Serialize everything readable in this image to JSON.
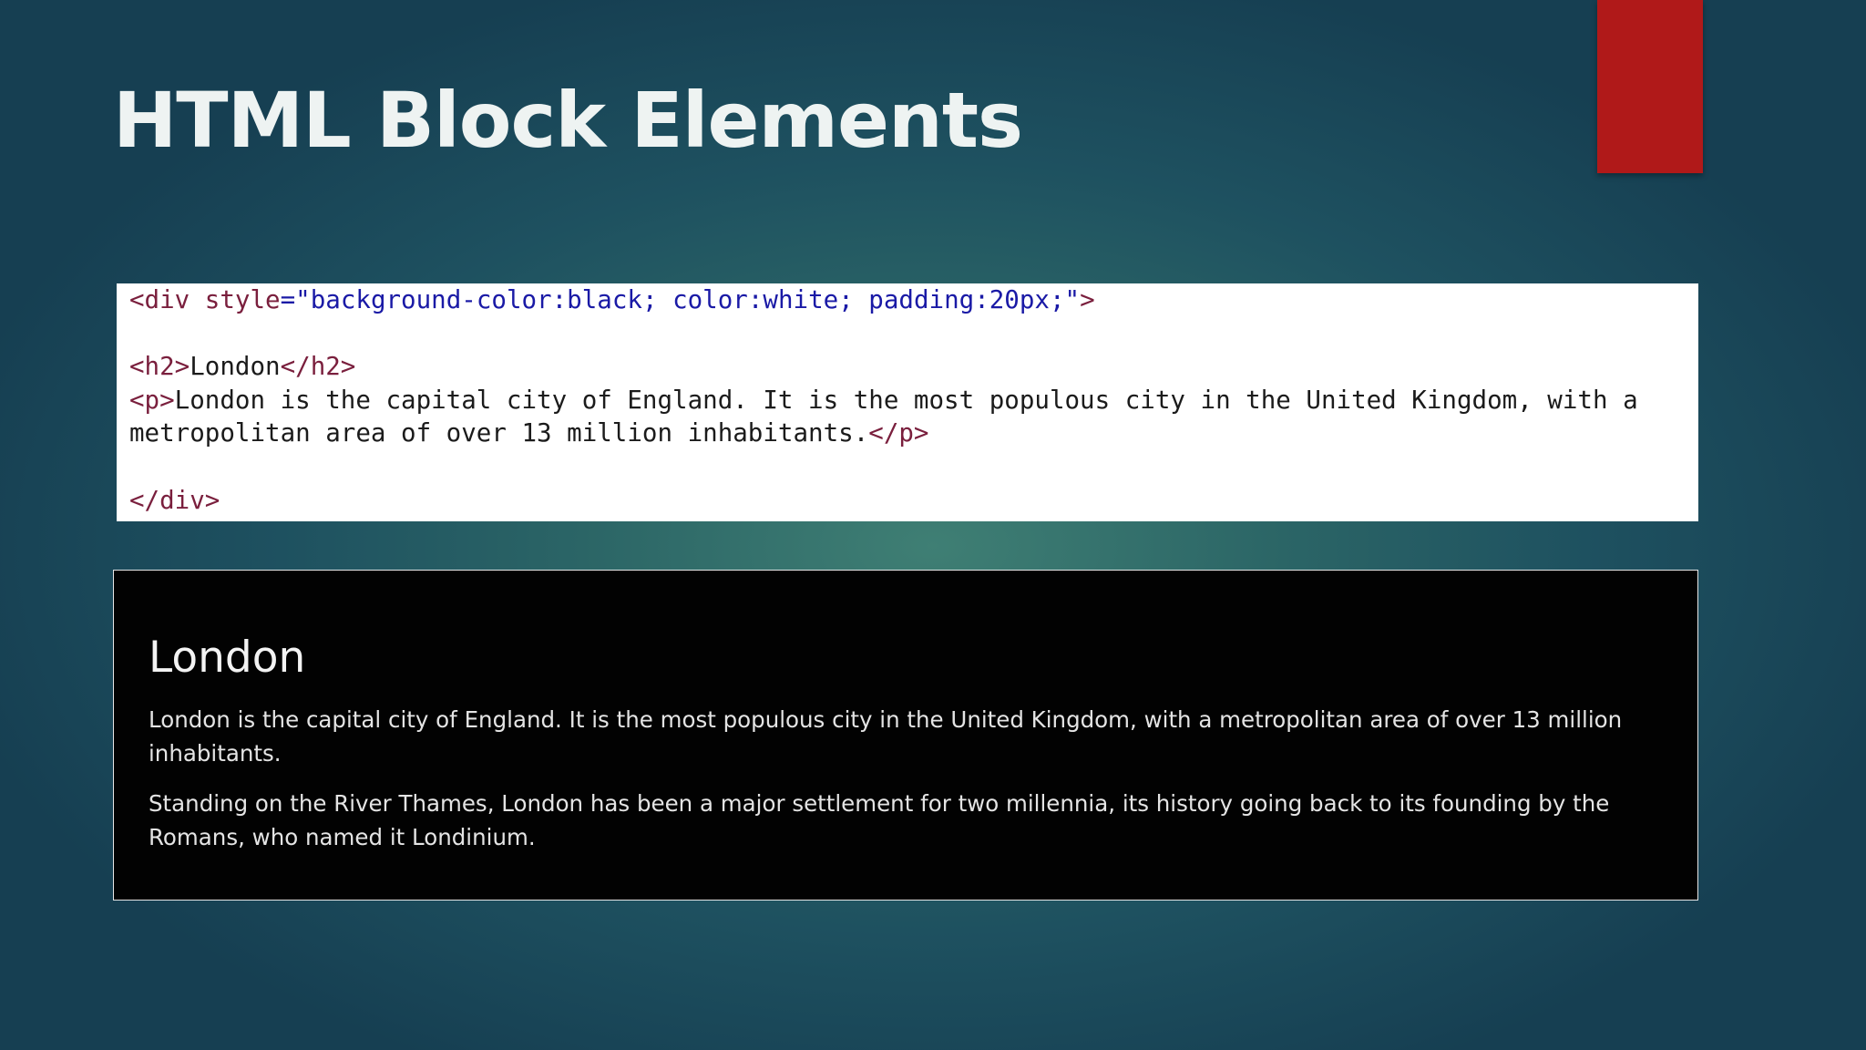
{
  "slide": {
    "title": "HTML Block Elements",
    "accent_color": "#b01919"
  },
  "code_panel": {
    "line1": {
      "tag_open": "<div ",
      "attr_name": "style",
      "equals": "=",
      "attr_value": "\"background-color:black; color:white; padding:20px;\"",
      "tag_close": ">"
    },
    "line2": {
      "tag_open": "<h2>",
      "text": "London",
      "tag_close": "</h2>"
    },
    "line3": {
      "tag_open": "<p>",
      "text": "London is the capital city of England. It is the most populous city in the United Kingdom, with a"
    },
    "line4": {
      "text": "metropolitan area of over 13 million inhabitants.",
      "tag_close": "</p>"
    },
    "line5": {
      "tag_close": "</div>"
    }
  },
  "render_panel": {
    "heading": "London",
    "paragraph1": "London is the capital city of England. It is the most populous city in the United Kingdom, with a metropolitan area of over 13 million inhabitants.",
    "paragraph2": "Standing on the River Thames, London has been a major settlement for two millennia, its history going back to its founding by the Romans, who named it Londinium."
  }
}
